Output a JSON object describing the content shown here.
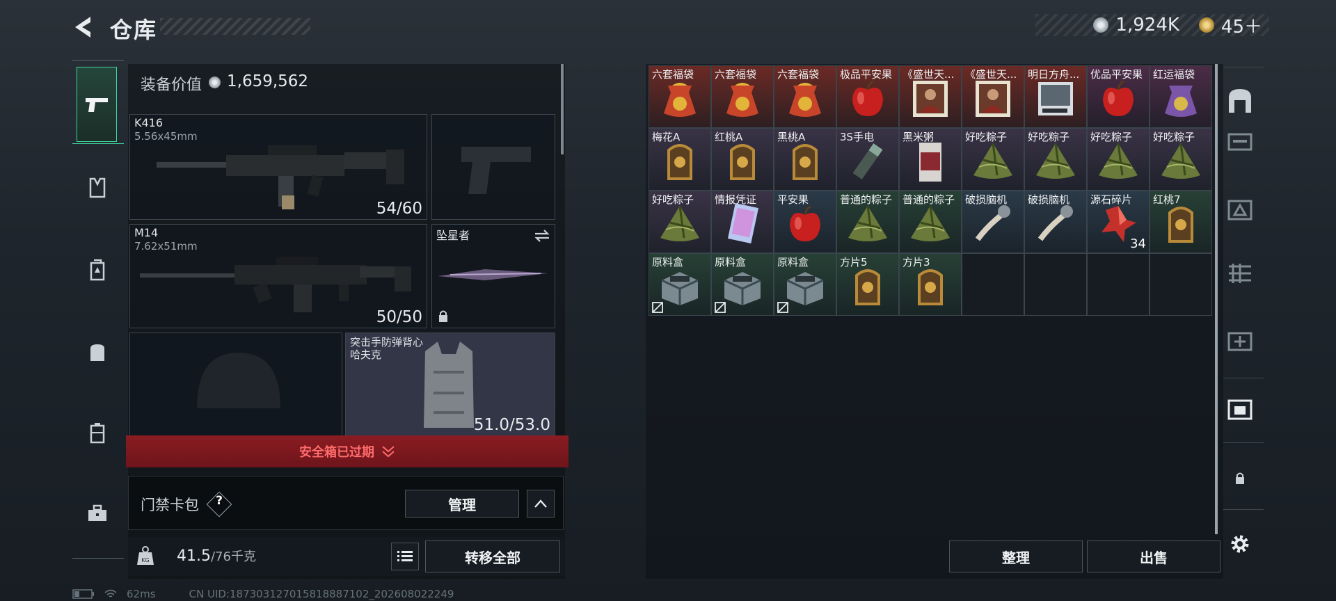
{
  "header": {
    "title": "仓库"
  },
  "currency": {
    "primary": "1,924K",
    "secondary": "45＋",
    "primary_color": "#b9c2c9",
    "secondary_color": "#c9a44a"
  },
  "equipment": {
    "label": "装备价值",
    "value": "1,659,562"
  },
  "slots": {
    "primary": {
      "name": "K416",
      "caliber": "5.56x45mm",
      "ammo": "54/60"
    },
    "secondary": {
      "name": "M14",
      "caliber": "7.62x51mm",
      "ammo": "50/50"
    },
    "melee": {
      "name": "坠星者"
    },
    "vest": {
      "name": "突击手防弹背心",
      "name2": "哈夫克",
      "durability": "51.0/53.0"
    }
  },
  "safe_box": {
    "label": "安全箱已过期",
    "color": "#ff6c6c"
  },
  "keycard": {
    "label": "门禁卡包",
    "help": "?",
    "manage": "管理"
  },
  "weight": {
    "current": "41.5",
    "max": "/76千克"
  },
  "actions": {
    "transfer_all": "转移全部",
    "sort": "整理",
    "sell": "出售"
  },
  "storage": {
    "items": [
      {
        "name": "六套福袋",
        "icon": "lucky-bag-icon",
        "bg": "#6b2a25"
      },
      {
        "name": "六套福袋",
        "icon": "lucky-bag-icon",
        "bg": "#6b2a25"
      },
      {
        "name": "六套福袋",
        "icon": "lucky-bag-icon",
        "bg": "#6b2a25"
      },
      {
        "name": "极品平安果",
        "icon": "apple-icon",
        "bg": "#6b2a25"
      },
      {
        "name": "《盛世天...",
        "icon": "painting-icon",
        "bg": "#6b2a25"
      },
      {
        "name": "《盛世天...",
        "icon": "painting-icon",
        "bg": "#6b2a25"
      },
      {
        "name": "明日方舟...",
        "icon": "card-icon",
        "bg": "#6b2a25"
      },
      {
        "name": "优品平安果",
        "icon": "apple-icon",
        "bg": "#4b2c46"
      },
      {
        "name": "红运福袋",
        "icon": "purple-bag-icon",
        "bg": "#4b2c46"
      },
      {
        "name": "梅花A",
        "icon": "token-card-icon",
        "bg": "#3a3346"
      },
      {
        "name": "红桃A",
        "icon": "token-card-icon",
        "bg": "#3a3346"
      },
      {
        "name": "黑桃A",
        "icon": "token-card-icon",
        "bg": "#3a3346"
      },
      {
        "name": "3S手电",
        "icon": "flashlight-icon",
        "bg": "#3a3346"
      },
      {
        "name": "黑米粥",
        "icon": "porridge-can-icon",
        "bg": "#3a3346"
      },
      {
        "name": "好吃粽子",
        "icon": "zongzi-icon",
        "bg": "#3a3346"
      },
      {
        "name": "好吃粽子",
        "icon": "zongzi-icon",
        "bg": "#3a3346"
      },
      {
        "name": "好吃粽子",
        "icon": "zongzi-icon",
        "bg": "#3a3346"
      },
      {
        "name": "好吃粽子",
        "icon": "zongzi-icon",
        "bg": "#3a3346"
      },
      {
        "name": "好吃粽子",
        "icon": "zongzi-icon",
        "bg": "#3a3346"
      },
      {
        "name": "情报凭证",
        "icon": "holo-card-icon",
        "bg": "#3a3346"
      },
      {
        "name": "平安果",
        "icon": "apple-icon",
        "bg": "#2b3a48"
      },
      {
        "name": "普通的粽子",
        "icon": "zongzi-icon",
        "bg": "#274035"
      },
      {
        "name": "普通的粽子",
        "icon": "zongzi-icon",
        "bg": "#274035"
      },
      {
        "name": "破损脑机",
        "icon": "brain-device-icon",
        "bg": "#2b3a48"
      },
      {
        "name": "破损脑机",
        "icon": "brain-device-icon",
        "bg": "#2b3a48"
      },
      {
        "name": "源石碎片",
        "icon": "crystal-icon",
        "bg": "#2b3a48",
        "count": "34"
      },
      {
        "name": "红桃7",
        "icon": "token-card-icon",
        "bg": "#274035"
      },
      {
        "name": "原料盒",
        "icon": "supply-box-icon",
        "bg": "#274035",
        "flag": true
      },
      {
        "name": "原料盒",
        "icon": "supply-box-icon",
        "bg": "#274035",
        "flag": true
      },
      {
        "name": "原料盒",
        "icon": "supply-box-icon",
        "bg": "#274035",
        "flag": true
      },
      {
        "name": "方片5",
        "icon": "token-card-icon",
        "bg": "#274035"
      },
      {
        "name": "方片3",
        "icon": "token-card-icon",
        "bg": "#274035"
      }
    ]
  },
  "status_bar": {
    "ping": "62ms",
    "uid": "CN UID:187303127015818887102_202608022249"
  }
}
